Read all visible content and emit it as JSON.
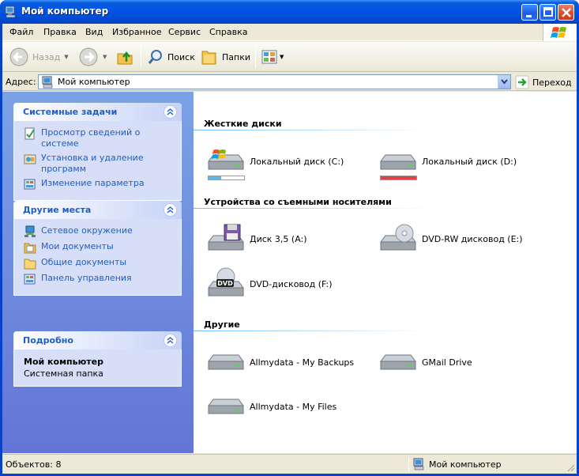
{
  "window": {
    "title": "Мой компьютер"
  },
  "menu": [
    "Файл",
    "Правка",
    "Вид",
    "Избранное",
    "Сервис",
    "Справка"
  ],
  "toolbar": {
    "back_label": "Назад",
    "search_label": "Поиск",
    "folders_label": "Папки"
  },
  "address": {
    "label": "Адрес:",
    "value": "Мой компьютер",
    "go_label": "Переход"
  },
  "tasks": {
    "system": {
      "title": "Системные задачи",
      "items": [
        "Просмотр сведений о системе",
        "Установка и удаление программ",
        "Изменение параметра"
      ]
    },
    "places": {
      "title": "Другие места",
      "items": [
        "Сетевое окружение",
        "Мои документы",
        "Общие документы",
        "Панель управления"
      ]
    },
    "details": {
      "title": "Подробно",
      "name": "Мой компьютер",
      "subtitle": "Системная папка"
    }
  },
  "groups": {
    "hard_disks": {
      "title": "Жесткие диски",
      "items": [
        {
          "label": "Локальный диск (C:)",
          "used_fraction": 0.35,
          "bar_color": "#5eb5e8"
        },
        {
          "label": "Локальный диск (D:)",
          "used_fraction": 1.0,
          "bar_color": "#d9434a"
        }
      ]
    },
    "removable": {
      "title": "Устройства со съемными носителями",
      "items": [
        {
          "label": "Диск 3,5 (A:)"
        },
        {
          "label": "DVD-RW дисковод (E:)"
        },
        {
          "label": "DVD-дисковод (F:)"
        }
      ]
    },
    "other": {
      "title": "Другие",
      "items": [
        {
          "label": "Allmydata - My Backups"
        },
        {
          "label": "GMail Drive"
        },
        {
          "label": "Allmydata - My Files"
        }
      ]
    }
  },
  "status": {
    "count": "Объектов: 8",
    "location": "Мой компьютер"
  },
  "colors": {
    "title_blue": "#0054e3",
    "link_blue": "#215dc6",
    "pane_blue": "#7ba2e7"
  }
}
